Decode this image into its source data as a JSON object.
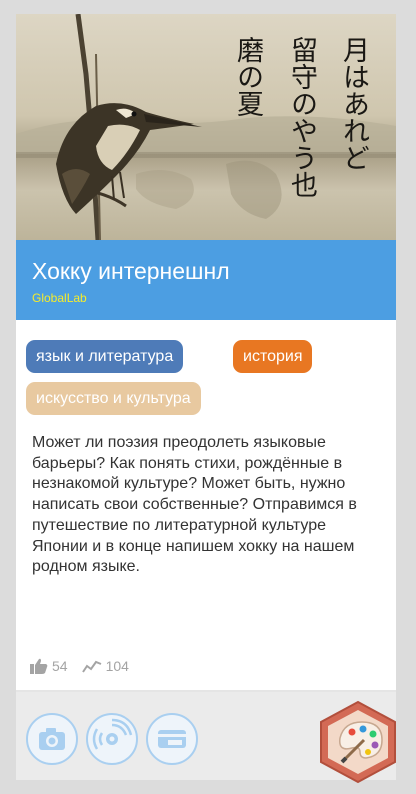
{
  "cover": {
    "poem_columns": [
      "月はあれど",
      "留守のやう也",
      "磨の夏"
    ]
  },
  "title": "Хокку интернешнл",
  "organization": "GlobalLab",
  "tags": [
    {
      "label": "язык и литература",
      "color": "#4e7bb8"
    },
    {
      "label": "история",
      "color": "#e87722"
    },
    {
      "label": "искусство и культура",
      "color": "#e8c9a0"
    }
  ],
  "description": "Может ли поэзия преодолеть языковые барьеры? Как понять стихи, рождённые в незнакомой культуре? Может быть, нужно написать свои собственные? Отправимся в путешествие по литературной культуре Японии и в конце напишем хокку на нашем родном языке.",
  "stats": {
    "likes": "54",
    "views": "104"
  },
  "bottom_icons": [
    "camera-icon",
    "sensor-icon",
    "card-icon"
  ],
  "badge_icon": "palette-icon",
  "colors": {
    "title_bar": "#4c9ee2",
    "organization": "#f6ec2a",
    "badge": "#d36a55"
  }
}
